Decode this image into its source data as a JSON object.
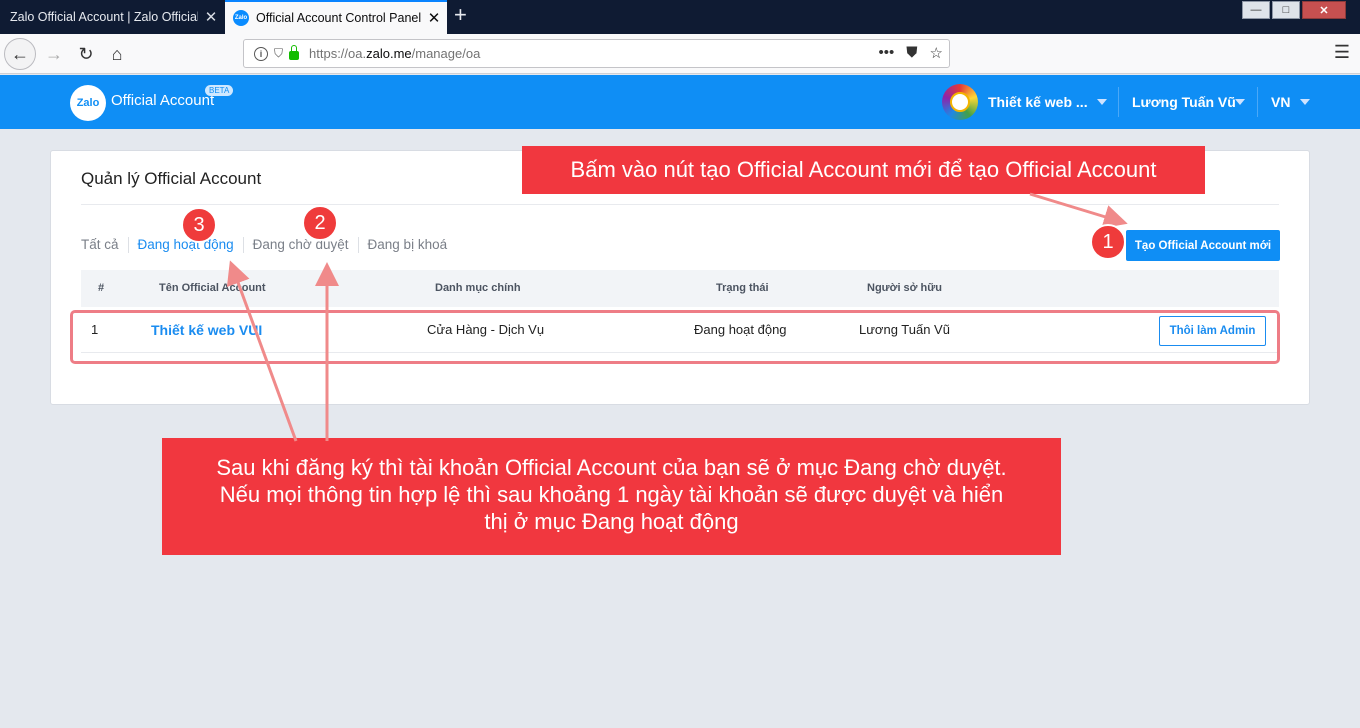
{
  "browser": {
    "tabs": [
      {
        "title": "Zalo Official Account | Zalo Official Account",
        "active": false
      },
      {
        "title": "Official Account Control Panel",
        "active": true
      }
    ],
    "address": {
      "prefix": "https://oa.",
      "domain": "zalo.me",
      "path": "/manage/oa"
    },
    "window_controls": {
      "minimize": "—",
      "maximize": "□",
      "close": "✕"
    }
  },
  "header": {
    "logo_text": "Zalo",
    "brand": "Official Account",
    "badge": "BETA",
    "account_name": "Thiết kế web ...",
    "user_name": "Lương Tuấn Vũ",
    "language": "VN"
  },
  "page": {
    "title": "Quản lý Official Account",
    "filters": [
      {
        "label": "Tất cả",
        "active": false
      },
      {
        "label": "Đang hoạt động",
        "active": true
      },
      {
        "label": "Đang chờ duyệt",
        "active": false
      },
      {
        "label": "Đang bị khoá",
        "active": false
      }
    ],
    "create_button": "Tạo Official Account mới",
    "table": {
      "columns": [
        "#",
        "Tên Official Account",
        "Danh mục chính",
        "Trạng thái",
        "Người sở hữu"
      ],
      "rows": [
        {
          "index": "1",
          "name": "Thiết kế web VUI",
          "category": "Cửa Hàng - Dịch Vụ",
          "status": "Đang hoạt động",
          "owner": "Lương Tuấn Vũ",
          "action": "Thôi làm Admin"
        }
      ]
    }
  },
  "annotations": {
    "top_callout": "Bấm vào nút tạo Official Account mới để tạo Official Account",
    "bottom_callout_lines": [
      "Sau khi đăng ký thì tài khoản Official Account của bạn sẽ ở mục Đang chờ duyệt.",
      "Nếu mọi thông tin hợp lệ thì sau khoảng 1 ngày tài khoản sẽ được duyệt và hiển",
      "thị ở mục Đang hoạt động"
    ],
    "badges": [
      "1",
      "2",
      "3"
    ],
    "colors": {
      "callout": "#f1373f",
      "arrow": "#f08a8a",
      "highlight": "#ee7d86"
    }
  }
}
